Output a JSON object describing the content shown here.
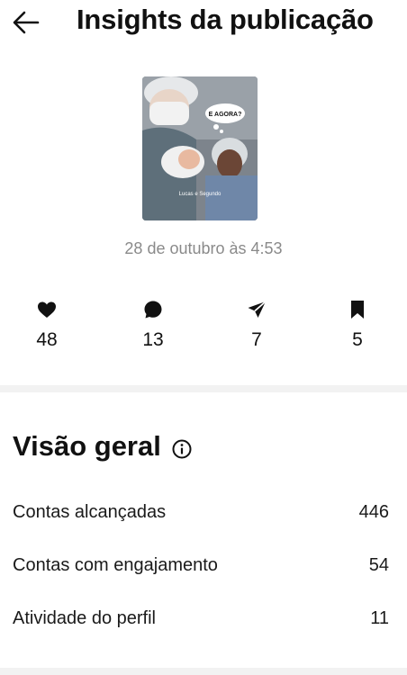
{
  "header": {
    "title": "Insights da publicação",
    "back_icon": "arrow-left-icon"
  },
  "post": {
    "thumbnail_bubble_text": "E AGORA?",
    "thumbnail_caption": "Lucas e Segundo",
    "date": "28 de outubro às 4:53"
  },
  "stats": [
    {
      "icon": "heart-icon",
      "value": "48"
    },
    {
      "icon": "comment-icon",
      "value": "13"
    },
    {
      "icon": "share-icon",
      "value": "7"
    },
    {
      "icon": "bookmark-icon",
      "value": "5"
    }
  ],
  "overview": {
    "title": "Visão geral",
    "info_icon": "info-icon",
    "rows": [
      {
        "label": "Contas alcançadas",
        "value": "446"
      },
      {
        "label": "Contas com engajamento",
        "value": "54"
      },
      {
        "label": "Atividade do perfil",
        "value": "11"
      }
    ]
  },
  "colors": {
    "text": "#111111",
    "muted": "#8a8a8a",
    "divider": "#f2f2f2"
  }
}
